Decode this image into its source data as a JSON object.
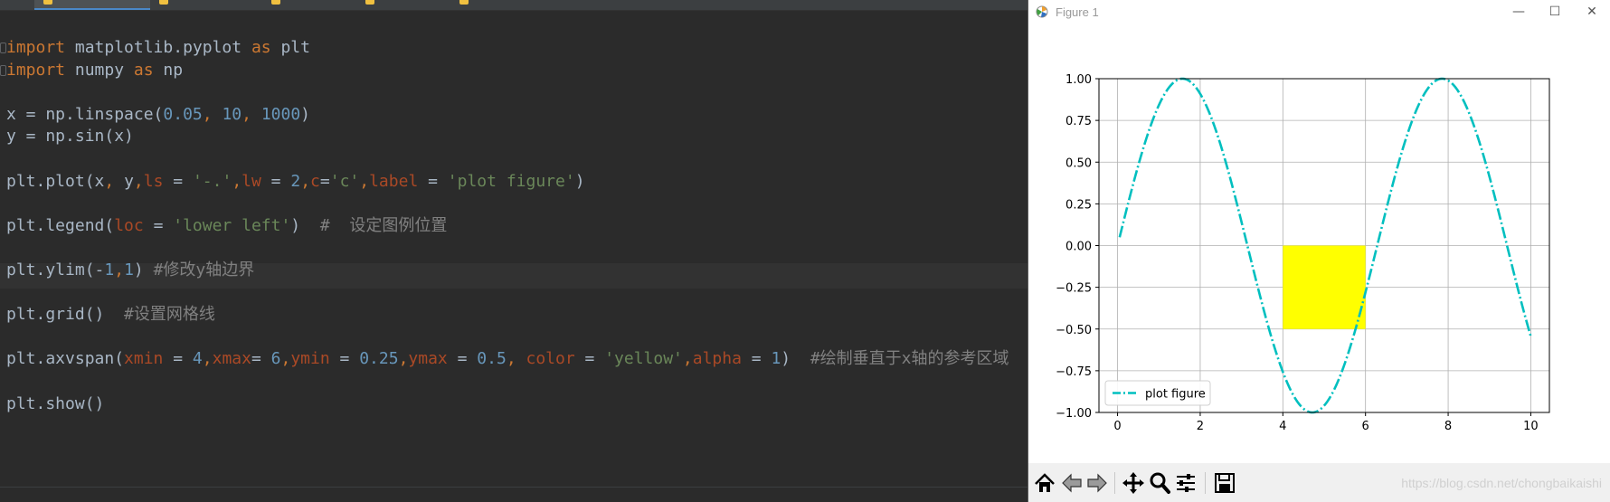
{
  "editor": {
    "lines": [
      [
        {
          "t": "import ",
          "c": "kw"
        },
        {
          "t": "matplotlib.pyplot "
        },
        {
          "t": "as ",
          "c": "kw"
        },
        {
          "t": "plt"
        }
      ],
      [
        {
          "t": "import ",
          "c": "kw"
        },
        {
          "t": "numpy "
        },
        {
          "t": "as ",
          "c": "kw"
        },
        {
          "t": "np"
        }
      ],
      [],
      [
        {
          "t": "x = np.linspace("
        },
        {
          "t": "0.05",
          "c": "num"
        },
        {
          "t": ", ",
          "c": "kw"
        },
        {
          "t": "10",
          "c": "num"
        },
        {
          "t": ", ",
          "c": "kw"
        },
        {
          "t": "1000",
          "c": "num"
        },
        {
          "t": ")"
        }
      ],
      [
        {
          "t": "y = np.sin(x)"
        }
      ],
      [],
      [
        {
          "t": "plt.plot(x"
        },
        {
          "t": ", ",
          "c": "kw"
        },
        {
          "t": "y"
        },
        {
          "t": ",",
          "c": "kw"
        },
        {
          "t": "ls",
          "c": "param"
        },
        {
          "t": " = "
        },
        {
          "t": "'-.'",
          "c": "str"
        },
        {
          "t": ",",
          "c": "kw"
        },
        {
          "t": "lw",
          "c": "param"
        },
        {
          "t": " = "
        },
        {
          "t": "2",
          "c": "num"
        },
        {
          "t": ",",
          "c": "kw"
        },
        {
          "t": "c",
          "c": "param"
        },
        {
          "t": "="
        },
        {
          "t": "'c'",
          "c": "str"
        },
        {
          "t": ",",
          "c": "kw"
        },
        {
          "t": "label",
          "c": "param"
        },
        {
          "t": " = "
        },
        {
          "t": "'plot figure'",
          "c": "str"
        },
        {
          "t": ")"
        }
      ],
      [],
      [
        {
          "t": "plt.legend("
        },
        {
          "t": "loc",
          "c": "param"
        },
        {
          "t": " = "
        },
        {
          "t": "'lower left'",
          "c": "str"
        },
        {
          "t": ")  "
        },
        {
          "t": "#  设定图例位置",
          "c": "cm"
        }
      ],
      [],
      [
        {
          "t": "plt.ylim(-"
        },
        {
          "t": "1",
          "c": "num"
        },
        {
          "t": ",",
          "c": "kw"
        },
        {
          "t": "1",
          "c": "num"
        },
        {
          "t": ") "
        },
        {
          "t": "#修改y轴边界",
          "c": "cm"
        }
      ],
      [],
      [
        {
          "t": "plt.grid()  "
        },
        {
          "t": "#设置网格线",
          "c": "cm"
        }
      ],
      [],
      [
        {
          "t": "plt.axvspan("
        },
        {
          "t": "xmin",
          "c": "param"
        },
        {
          "t": " = "
        },
        {
          "t": "4",
          "c": "num"
        },
        {
          "t": ",",
          "c": "kw"
        },
        {
          "t": "xmax",
          "c": "param"
        },
        {
          "t": "= "
        },
        {
          "t": "6",
          "c": "num"
        },
        {
          "t": ",",
          "c": "kw"
        },
        {
          "t": "ymin",
          "c": "param"
        },
        {
          "t": " = "
        },
        {
          "t": "0.25",
          "c": "num"
        },
        {
          "t": ",",
          "c": "kw"
        },
        {
          "t": "ymax",
          "c": "param"
        },
        {
          "t": " = "
        },
        {
          "t": "0.5",
          "c": "num"
        },
        {
          "t": ", ",
          "c": "kw"
        },
        {
          "t": "color",
          "c": "param"
        },
        {
          "t": " = "
        },
        {
          "t": "'yellow'",
          "c": "str"
        },
        {
          "t": ",",
          "c": "kw"
        },
        {
          "t": "alpha",
          "c": "param"
        },
        {
          "t": " = "
        },
        {
          "t": "1",
          "c": "num"
        },
        {
          "t": ")  "
        },
        {
          "t": "#绘制垂直于x轴的参考区域",
          "c": "cm"
        }
      ],
      [],
      [
        {
          "t": "plt.show()"
        }
      ]
    ]
  },
  "figure": {
    "title": "Figure 1",
    "minimize_glyph": "—",
    "maximize_glyph": "☐",
    "close_glyph": "✕",
    "watermark": "https://blog.csdn.net/chongbaikaishi",
    "toolbar_icons": [
      "home-icon",
      "back-icon",
      "forward-icon",
      "pan-icon",
      "zoom-icon",
      "configure-subplots-icon",
      "save-icon"
    ]
  },
  "chart_data": {
    "type": "line",
    "title": "",
    "xlabel": "",
    "ylabel": "",
    "xlim": [
      -0.45,
      10.45
    ],
    "ylim": [
      -1,
      1
    ],
    "xticks": [
      0,
      2,
      4,
      6,
      8,
      10
    ],
    "xtick_labels": [
      "0",
      "2",
      "4",
      "6",
      "8",
      "10"
    ],
    "yticks": [
      -1.0,
      -0.75,
      -0.5,
      -0.25,
      0.0,
      0.25,
      0.5,
      0.75,
      1.0
    ],
    "ytick_labels": [
      "−1.00",
      "−0.75",
      "−0.50",
      "−0.25",
      "0.00",
      "0.25",
      "0.50",
      "0.75",
      "1.00"
    ],
    "grid": true,
    "legend": {
      "loc": "lower left",
      "entries": [
        "plot figure"
      ]
    },
    "series": [
      {
        "name": "plot figure",
        "function": "sin(x)",
        "x_start": 0.05,
        "x_end": 10,
        "n_points": 1000,
        "color": "#00bfbf",
        "linestyle": "-.",
        "linewidth": 2
      }
    ],
    "axvspan": {
      "xmin": 4,
      "xmax": 6,
      "ymin": 0.25,
      "ymax": 0.5,
      "color": "#ffff00"
    }
  }
}
